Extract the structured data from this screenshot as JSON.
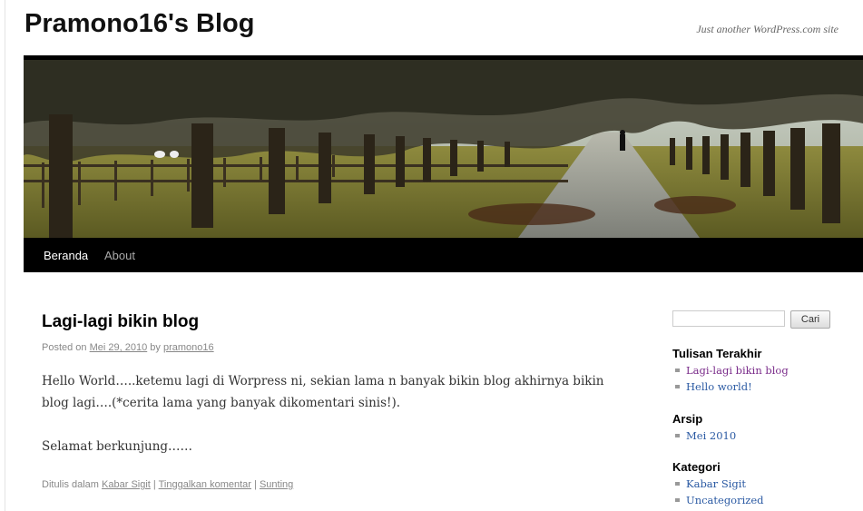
{
  "site": {
    "title": "Pramono16's Blog",
    "description": "Just another WordPress.com site"
  },
  "nav": {
    "items": [
      {
        "label": "Beranda"
      },
      {
        "label": "About"
      }
    ]
  },
  "post": {
    "title": "Lagi-lagi bikin blog",
    "meta_prefix": "Posted on",
    "date": "Mei 29, 2010",
    "meta_by": "by",
    "author": "pramono16",
    "paragraphs": [
      "Hello World…..ketemu lagi di Worpress ni, sekian lama n banyak bikin blog akhirnya bikin blog lagi….(*cerita lama yang banyak dikomentari sinis!).",
      "Selamat berkunjung……"
    ],
    "footer": {
      "prefix": "Ditulis dalam",
      "category": "Kabar Sigit",
      "sep1": "|",
      "comment_link": "Tinggalkan komentar",
      "sep2": "|",
      "edit_link": "Sunting"
    }
  },
  "sidebar": {
    "search": {
      "value": "",
      "button_label": "Cari"
    },
    "recent_posts": {
      "title": "Tulisan Terakhir",
      "items": [
        "Lagi-lagi bikin blog",
        "Hello world!"
      ]
    },
    "archives": {
      "title": "Arsip",
      "items": [
        "Mei 2010"
      ]
    },
    "categories": {
      "title": "Kategori",
      "items": [
        "Kabar Sigit",
        "Uncategorized"
      ]
    }
  },
  "colors": {
    "link": "#2b5aa3",
    "visited_link": "#7a2c8a",
    "nav_bg": "#000000"
  }
}
